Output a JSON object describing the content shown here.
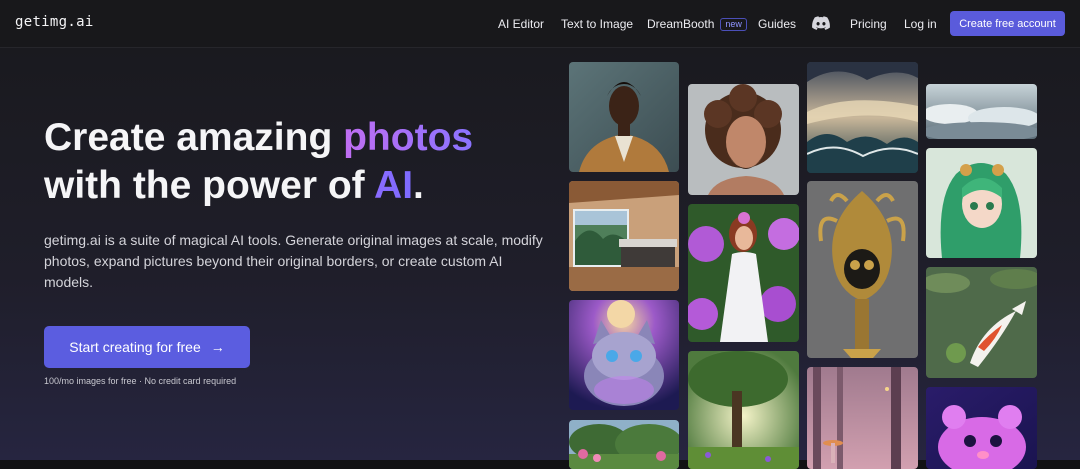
{
  "header": {
    "logo": "getimg.ai",
    "nav": {
      "ai_editor": "AI Editor",
      "text_to_image": "Text to Image",
      "dreambooth": "DreamBooth",
      "dreambooth_badge": "new",
      "guides": "Guides",
      "pricing": "Pricing",
      "login": "Log in"
    },
    "cta": "Create free account"
  },
  "hero": {
    "title_line1_plain": "Create amazing ",
    "title_line1_highlight": "photos",
    "title_line2_plain": "with the power of ",
    "title_line2_highlight": "AI",
    "title_line2_end": ".",
    "description": "getimg.ai is a suite of magical AI tools. Generate original images at scale, modify photos, expand pictures beyond their original borders, or create custom AI models.",
    "button_label": "Start creating for free",
    "button_arrow": "→",
    "fine_print": "100/mo images for free · No credit card required"
  },
  "colors": {
    "accent": "#5b5de0",
    "highlight_gradient_start": "#c06ef2",
    "highlight_gradient_end": "#8a73ff",
    "background": "#1f1e2a"
  },
  "gallery": [
    {
      "name": "portrait-man-tan-jacket"
    },
    {
      "name": "curly-haired-man"
    },
    {
      "name": "stormy-sea"
    },
    {
      "name": "cloudscape"
    },
    {
      "name": "bedroom-forest-view"
    },
    {
      "name": "woman-in-white-dress-flowers"
    },
    {
      "name": "golden-skull-ornament"
    },
    {
      "name": "green-haired-anime-girl"
    },
    {
      "name": "cosmic-cat"
    },
    {
      "name": "koi-fish-pond"
    },
    {
      "name": "sunlit-tree"
    },
    {
      "name": "misty-forest-lanterns"
    },
    {
      "name": "neon-hamster"
    },
    {
      "name": "flower-garden"
    }
  ]
}
